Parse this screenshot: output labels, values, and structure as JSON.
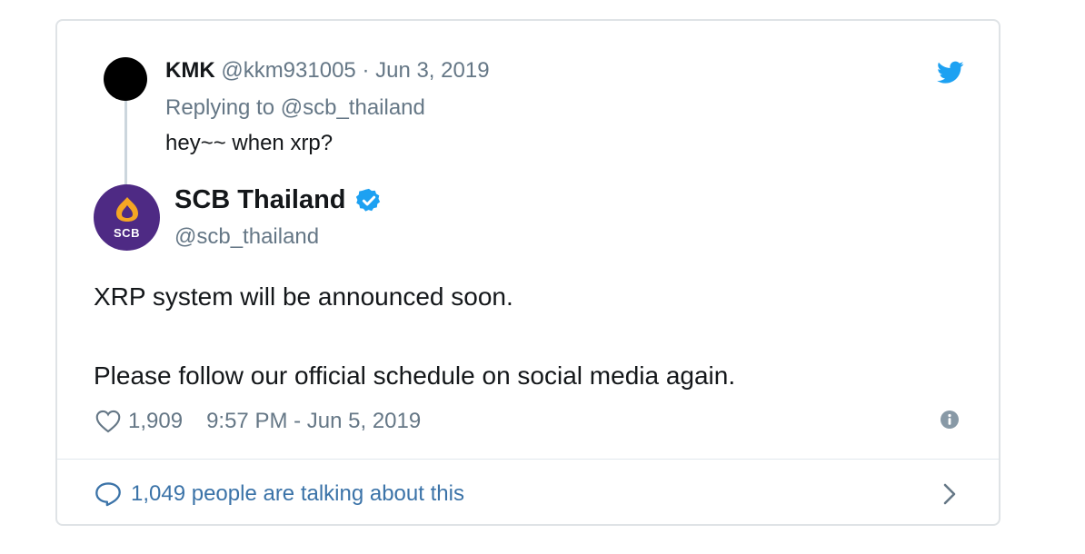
{
  "reply": {
    "name": "KMK",
    "meta": "@kkm931005 · Jun 3, 2019",
    "replying_to": "Replying to @scb_thailand",
    "text": "hey~~ when xrp?"
  },
  "tweet": {
    "avatar_text": "SCB",
    "name": "SCB Thailand",
    "handle": "@scb_thailand",
    "body_line_1": "XRP system will be announced soon.",
    "body_line_2": "Please follow our official schedule on social media again.",
    "likes": "1,909",
    "timestamp": "9:57 PM - Jun 5, 2019"
  },
  "footer": {
    "talking": "1,049 people are talking about this"
  },
  "colors": {
    "twitter_blue": "#1da1f2",
    "scb_purple": "#4e2a84",
    "scb_gold": "#f5a623",
    "muted": "#657786",
    "link": "#3b73a8"
  },
  "icons": [
    "twitter-bird-icon",
    "verified-badge-icon",
    "heart-icon",
    "info-icon",
    "comment-bubble-icon",
    "chevron-right-icon"
  ]
}
